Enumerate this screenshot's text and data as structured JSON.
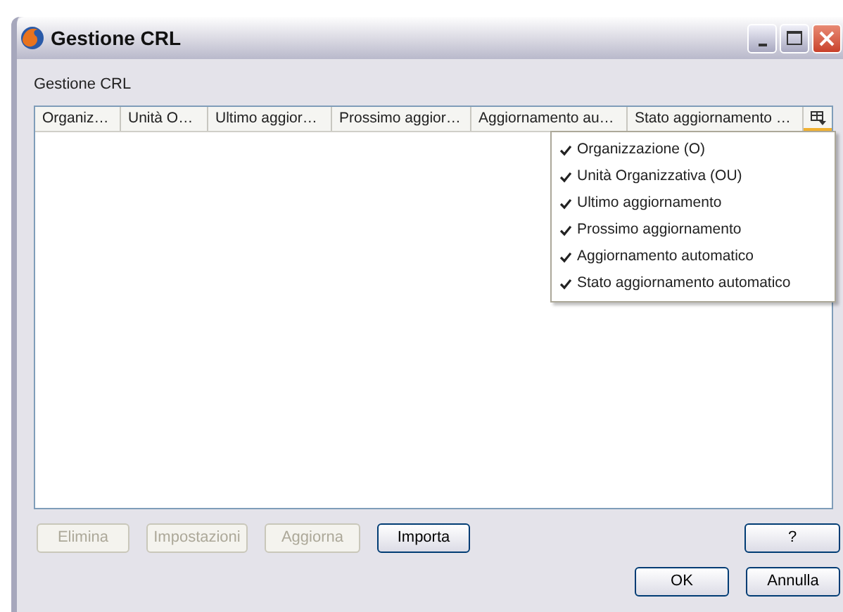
{
  "window": {
    "title": "Gestione CRL"
  },
  "heading": "Gestione CRL",
  "table": {
    "columns": [
      "Organiz…",
      "Unità O…",
      "Ultimo aggior…",
      "Prossimo aggior…",
      "Aggiornamento au…",
      "Stato aggiornamento …"
    ]
  },
  "column_menu": [
    {
      "label": "Organizzazione (O)",
      "checked": true
    },
    {
      "label": "Unità Organizzativa (OU)",
      "checked": true
    },
    {
      "label": "Ultimo aggiornamento",
      "checked": true
    },
    {
      "label": "Prossimo aggiornamento",
      "checked": true
    },
    {
      "label": "Aggiornamento automatico",
      "checked": true
    },
    {
      "label": "Stato aggiornamento automatico",
      "checked": true
    }
  ],
  "actions": [
    {
      "label": "Elimina",
      "disabled": true
    },
    {
      "label": "Impostazioni",
      "disabled": true
    },
    {
      "label": "Aggiorna",
      "disabled": true
    },
    {
      "label": "Importa",
      "disabled": false
    }
  ],
  "help_button": "?",
  "buttons": [
    "OK",
    "Annulla"
  ]
}
